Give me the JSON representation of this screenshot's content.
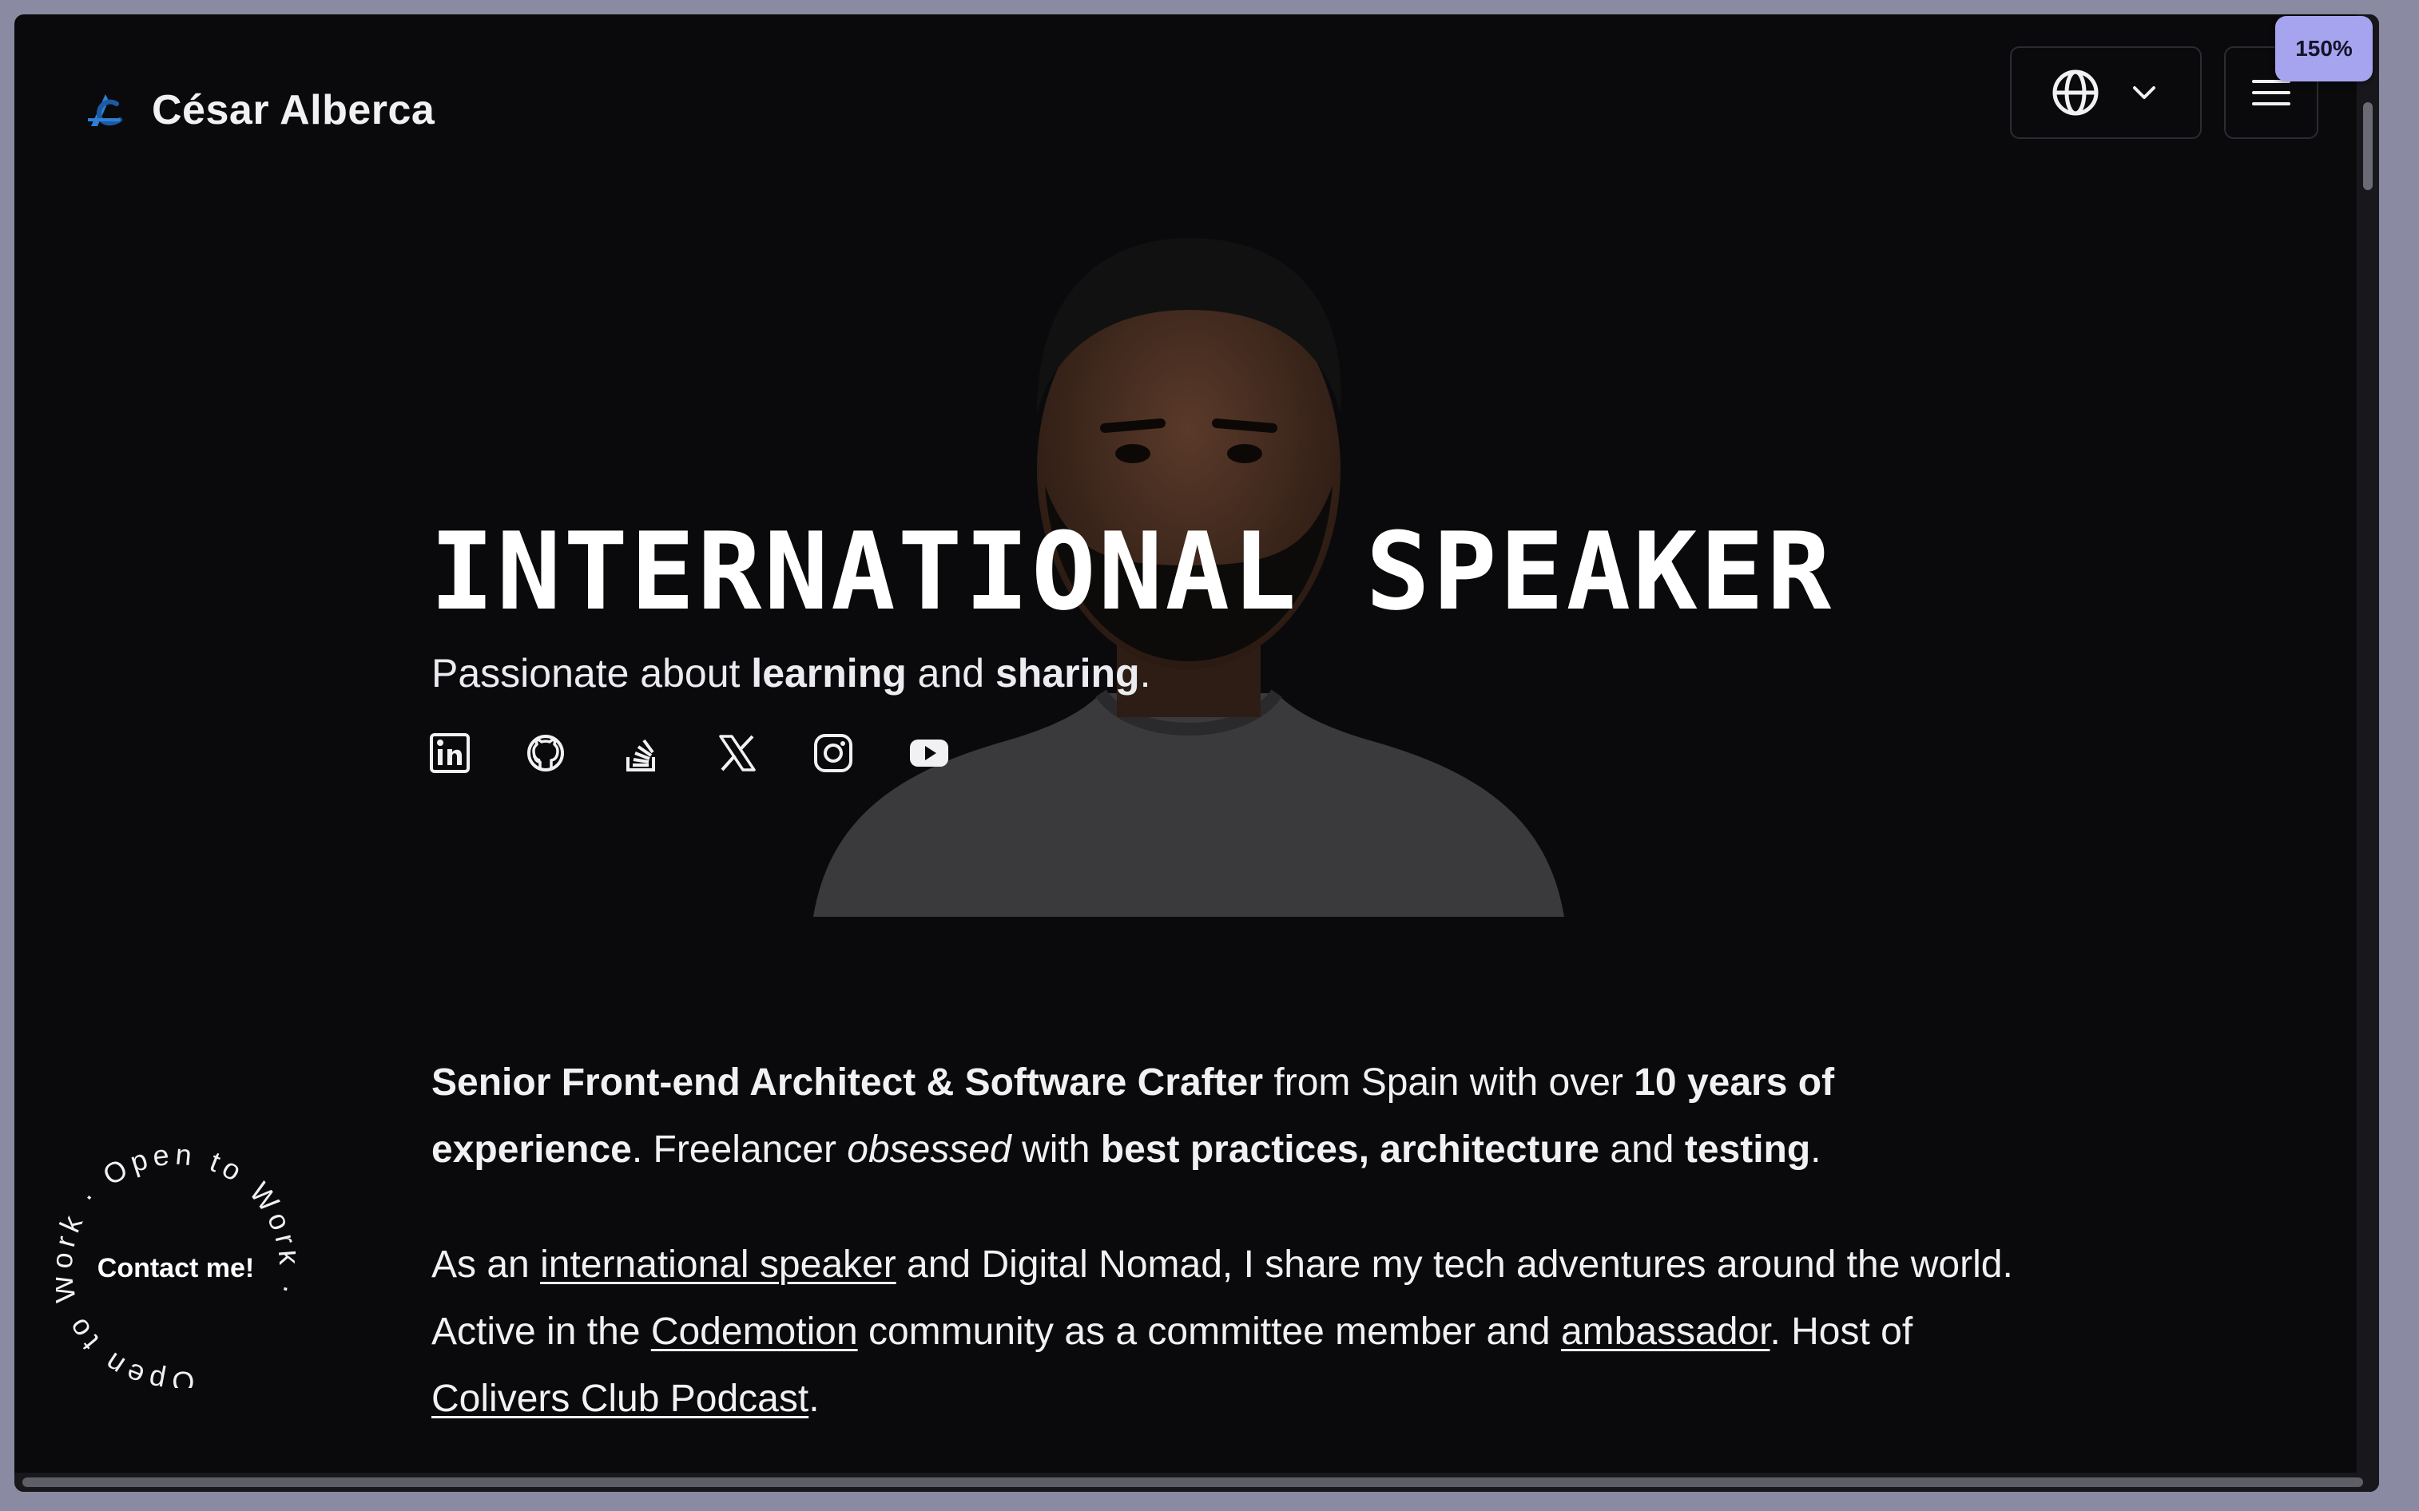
{
  "header": {
    "brand_name": "César Alberca",
    "logo_icon": "ca-monogram-icon",
    "language_icon": "globe-icon",
    "language_chevron_icon": "chevron-down-icon",
    "menu_icon": "hamburger-menu-icon"
  },
  "zoom_badge": "150%",
  "hero": {
    "title": "INTERNATIONAL SPEAKER",
    "subtitle_1": "Passionate about ",
    "subtitle_bold_1": "learning",
    "subtitle_2": " and ",
    "subtitle_bold_2": "sharing",
    "subtitle_3": ".",
    "portrait_alt": "portrait-photo",
    "socials": [
      "linkedin-icon",
      "github-icon",
      "stackoverflow-icon",
      "x-twitter-icon",
      "instagram-icon",
      "youtube-icon"
    ]
  },
  "about": {
    "p1": {
      "role": "Senior Front-end Architect & Software Crafter",
      "t1": " from Spain with over ",
      "years": "10 years of experience",
      "t2": ". Freelancer ",
      "obsessed": "obsessed",
      "t3": " with ",
      "practices": "best practices, architecture",
      "t4": " and ",
      "testing": "testing",
      "t5": "."
    },
    "p2": {
      "t1": "As an ",
      "link_speaker": "international speaker",
      "t2": " and Digital Nomad, I share my tech adventures around the world. Active in the ",
      "link_codemotion": "Codemotion",
      "t3": " community as a committee member and ",
      "link_ambassador": "ambassador",
      "t4": ". Host of ",
      "link_podcast": "Colivers Club Podcast",
      "t5": "."
    }
  },
  "contact_badge": {
    "label": "Contact me!",
    "ring_text": "Open to Work · Open to Work · "
  },
  "colors": {
    "background": "#0a0a0d",
    "text": "#f1f1f4",
    "badge": "#a6a3ef",
    "logo_blue": "#2f7fd6"
  }
}
